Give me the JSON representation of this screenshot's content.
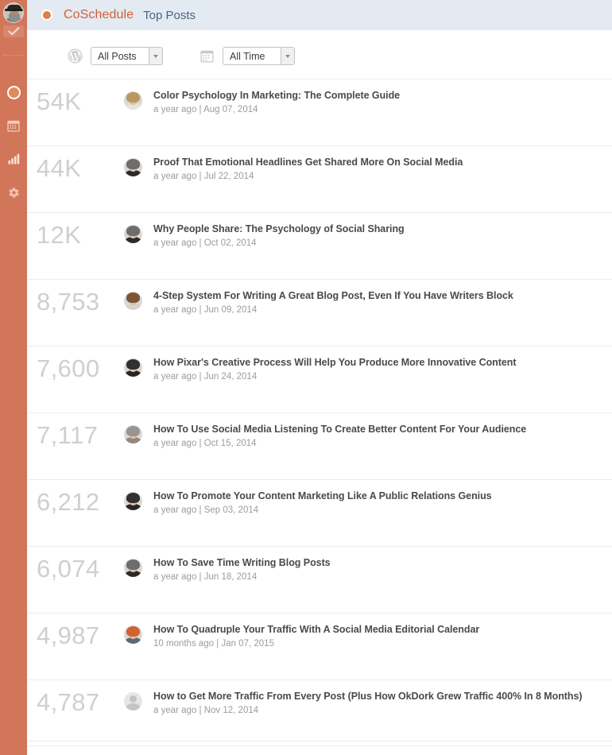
{
  "sidebar": {
    "avatar_name": "user-avatar",
    "badge_icon": "checkmark-icon",
    "items": [
      {
        "icon": "circle-dashboard-icon",
        "name": "dashboard",
        "active": true
      },
      {
        "icon": "calendar-icon",
        "name": "calendar",
        "active": false
      },
      {
        "icon": "bar-chart-icon",
        "name": "analytics",
        "active": false
      },
      {
        "icon": "gear-icon",
        "name": "settings",
        "active": false
      }
    ]
  },
  "header": {
    "brand_dot_color": "#dd8041",
    "brand": "CoSchedule",
    "page_title": "Top Posts",
    "background": "#e3eaf1",
    "brand_color": "#d2603a",
    "title_color": "#4c6480"
  },
  "filters": [
    {
      "icon": "wordpress-icon",
      "name": "post-type-filter",
      "value": "All Posts",
      "options": [
        "All Posts"
      ]
    },
    {
      "icon": "calendar-icon",
      "name": "time-range-filter",
      "value": "All Time",
      "options": [
        "All Time"
      ]
    }
  ],
  "posts": [
    {
      "count": "54K",
      "title": "Color Psychology In Marketing: The Complete Guide",
      "meta": "a year ago | Aug 07, 2014",
      "avatar": "woman-blonde"
    },
    {
      "count": "44K",
      "title": "Proof That Emotional Headlines Get Shared More On Social Media",
      "meta": "a year ago | Jul 22, 2014",
      "avatar": "man-glasses"
    },
    {
      "count": "12K",
      "title": "Why People Share: The Psychology of Social Sharing",
      "meta": "a year ago | Oct 02, 2014",
      "avatar": "man-glasses"
    },
    {
      "count": "8,753",
      "title": "4-Step System For Writing A Great Blog Post, Even If You Have Writers Block",
      "meta": "a year ago | Jun 09, 2014",
      "avatar": "woman-brown"
    },
    {
      "count": "7,600",
      "title": "How Pixar's Creative Process Will Help You Produce More Innovative Content",
      "meta": "a year ago | Jun 24, 2014",
      "avatar": "man-dark"
    },
    {
      "count": "7,117",
      "title": "How To Use Social Media Listening To Create Better Content For Your Audience",
      "meta": "a year ago | Oct 15, 2014",
      "avatar": "man-beard"
    },
    {
      "count": "6,212",
      "title": "How To Promote Your Content Marketing Like A Public Relations Genius",
      "meta": "a year ago | Sep 03, 2014",
      "avatar": "man-dark"
    },
    {
      "count": "6,074",
      "title": "How To Save Time Writing Blog Posts",
      "meta": "a year ago | Jun 18, 2014",
      "avatar": "man-glasses"
    },
    {
      "count": "4,987",
      "title": "How To Quadruple Your Traffic With A Social Media Editorial Calendar",
      "meta": "10 months ago | Jan 07, 2015",
      "avatar": "man-orange"
    },
    {
      "count": "4,787",
      "title": "How to Get More Traffic From Every Post (Plus How OkDork Grew Traffic 400% In 8 Months)",
      "meta": "a year ago | Nov 12, 2014",
      "avatar": "generic"
    }
  ]
}
